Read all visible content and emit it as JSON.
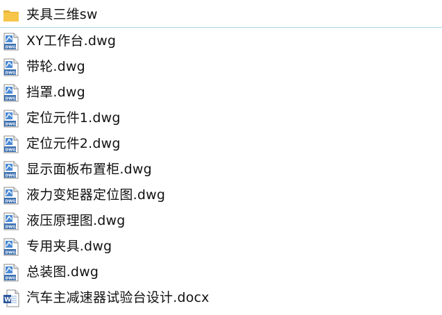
{
  "files": [
    {
      "name": "夹具三维sw",
      "icon": "folder-icon",
      "type": "folder"
    },
    {
      "name": "XY工作台.dwg",
      "icon": "dwg-file-icon",
      "type": "dwg"
    },
    {
      "name": "带轮.dwg",
      "icon": "dwg-file-icon",
      "type": "dwg"
    },
    {
      "name": "挡罩.dwg",
      "icon": "dwg-file-icon",
      "type": "dwg"
    },
    {
      "name": "定位元件1.dwg",
      "icon": "dwg-file-icon",
      "type": "dwg"
    },
    {
      "name": "定位元件2.dwg",
      "icon": "dwg-file-icon",
      "type": "dwg"
    },
    {
      "name": "显示面板布置柜.dwg",
      "icon": "dwg-file-icon",
      "type": "dwg"
    },
    {
      "name": "液力变矩器定位图.dwg",
      "icon": "dwg-file-icon",
      "type": "dwg"
    },
    {
      "name": "液压原理图.dwg",
      "icon": "dwg-file-icon",
      "type": "dwg"
    },
    {
      "name": "专用夹具.dwg",
      "icon": "dwg-file-icon",
      "type": "dwg"
    },
    {
      "name": "总装图.dwg",
      "icon": "dwg-file-icon",
      "type": "dwg"
    },
    {
      "name": "汽车主减速器试验台设计.docx",
      "icon": "word-file-icon",
      "type": "docx"
    }
  ],
  "colors": {
    "selection_border": "#a9d3e7",
    "folder": "#f7c548",
    "dwg_blue": "#3a6fb0",
    "word_blue": "#2b579a"
  }
}
